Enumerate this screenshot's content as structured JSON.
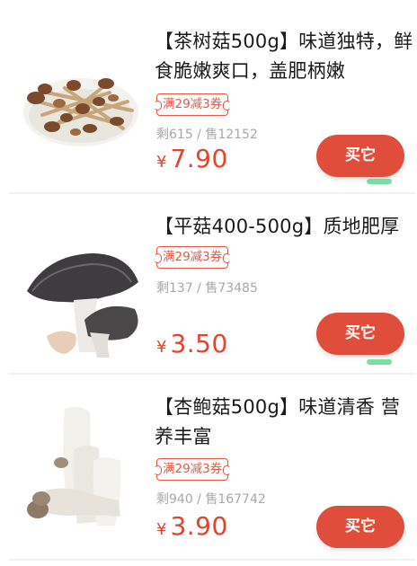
{
  "products": [
    {
      "title": "【茶树菇500g】味道独特，鲜食脆嫩爽口，盖肥柄嫩",
      "coupon": "满29减3券",
      "stock": "剩615 / 售12152",
      "price_symbol": "¥",
      "price": "7.90",
      "buy_label": "买它"
    },
    {
      "title": "【平菇400-500g】质地肥厚",
      "coupon": "满29减3券",
      "stock": "剩137 / 售73485",
      "price_symbol": "¥",
      "price": "3.50",
      "buy_label": "买它"
    },
    {
      "title": "【杏鲍菇500g】味道清香 营养丰富",
      "coupon": "满29减3券",
      "stock": "剩940 / 售167742",
      "price_symbol": "¥",
      "price": "3.90",
      "buy_label": "买它"
    }
  ],
  "colors": {
    "price": "#e4432d",
    "button": "#e14d3b",
    "coupon": "#e4563f",
    "muted": "#a8a8a8"
  }
}
